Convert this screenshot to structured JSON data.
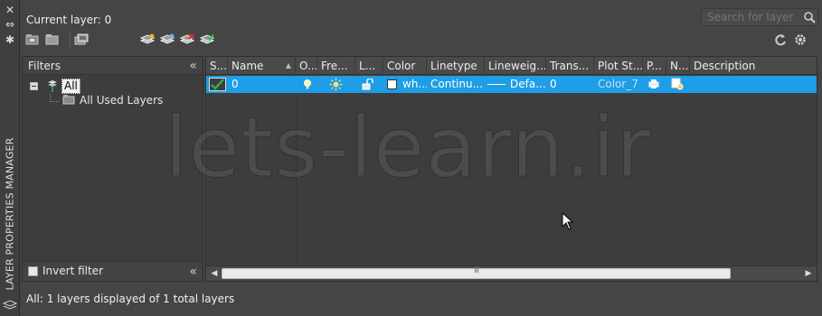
{
  "panel": {
    "vertical_title": "LAYER PROPERTIES MANAGER",
    "current_layer": "Current layer: 0",
    "search_placeholder": "Search for layer",
    "status": "All: 1 layers displayed of 1 total layers",
    "watermark": "lets-learn.ir"
  },
  "filters": {
    "header": "Filters",
    "tree": [
      {
        "label": "All"
      },
      {
        "label": "All Used Layers"
      }
    ],
    "invert_label": "Invert filter"
  },
  "columns": [
    "S...",
    "Name",
    "O...",
    "Fre...",
    "L...",
    "Color",
    "Linetype",
    "Lineweig...",
    "Trans...",
    "Plot St...",
    "P...",
    "N...",
    "Description"
  ],
  "rows": [
    {
      "name": "0",
      "color_name": "wh...",
      "linetype": "Continu...",
      "lineweight": "Defa...",
      "transparency": "0",
      "plot_style": "Color_7",
      "description": ""
    }
  ],
  "colors": {
    "selection": "#1f9de5",
    "panel": "#454545"
  },
  "scroll": {
    "thumb_grip": "III"
  }
}
